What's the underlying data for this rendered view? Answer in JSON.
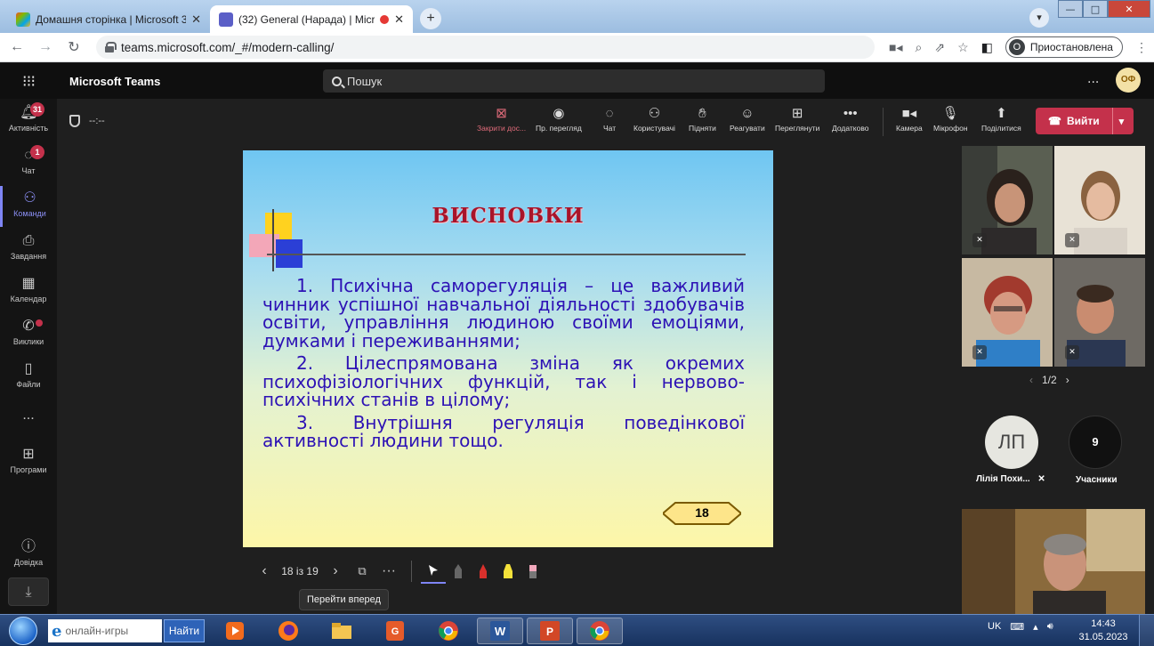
{
  "browser": {
    "tabs": [
      {
        "title": "Домашня сторінка | Microsoft 3",
        "active": false
      },
      {
        "title": "(32) General (Нарада) | Micro",
        "active": true
      }
    ],
    "new_tab": "+",
    "url": "teams.microsoft.com/_#/modern-calling/",
    "profile_initial": "О",
    "profile_status": "Приостановлена"
  },
  "teams": {
    "brand": "Microsoft Teams",
    "search_placeholder": "Пошук",
    "more": "...",
    "user_initials": "ОФ"
  },
  "rail": {
    "items": [
      {
        "label": "Активність",
        "icon": "bell-icon",
        "badge": "31"
      },
      {
        "label": "Чат",
        "icon": "chat-icon",
        "badge": "1"
      },
      {
        "label": "Команди",
        "icon": "teams-icon",
        "active": true
      },
      {
        "label": "Завдання",
        "icon": "tasks-icon"
      },
      {
        "label": "Календар",
        "icon": "calendar-icon"
      },
      {
        "label": "Виклики",
        "icon": "calls-icon"
      },
      {
        "label": "Файли",
        "icon": "files-icon"
      },
      {
        "label": "...",
        "icon": "more-icon"
      },
      {
        "label": "Програми",
        "icon": "apps-icon"
      },
      {
        "label": "Довідка",
        "icon": "help-icon"
      }
    ]
  },
  "meeting": {
    "timer": "--:--",
    "toolbar": {
      "stop_share": "Закрити дос...",
      "presenter_view": "Пр. перегляд",
      "chat": "Чат",
      "people": "Користувачі",
      "raise": "Підняти",
      "react": "Реагувати",
      "view": "Переглянути",
      "more": "Додатково",
      "camera": "Камера",
      "mic": "Мікрофон",
      "share": "Поділитися"
    },
    "leave_label": "Вийти"
  },
  "slide": {
    "title": "ВИСНОВКИ",
    "paragraphs": [
      "1. Психічна саморегуляція – це важливий чинник успішної навчальної діяльності здобувачів освіти, управління людиною своїми емоціями, думками і переживаннями;",
      "2. Цілеспрямована зміна як окремих психофізіологічних функцій, так і нервово-психічних станів в цілому;",
      "3. Внутрішня регуляція поведінкової активності людини тощо."
    ],
    "number": "18",
    "colors": {
      "title": "#a8142a",
      "body": "#2d12b5"
    }
  },
  "slide_controls": {
    "counter": "18 із 19",
    "more": "···",
    "tooltip": "Перейти вперед"
  },
  "participants": {
    "pager": "1/2",
    "initials": "ЛП",
    "name": "Лілія Похи...",
    "count": "9",
    "count_label": "Учасники"
  },
  "taskbar": {
    "search_placeholder": "онлайн-игры",
    "search_go": "Найти",
    "language": "UK",
    "time": "14:43",
    "date": "31.05.2023"
  }
}
